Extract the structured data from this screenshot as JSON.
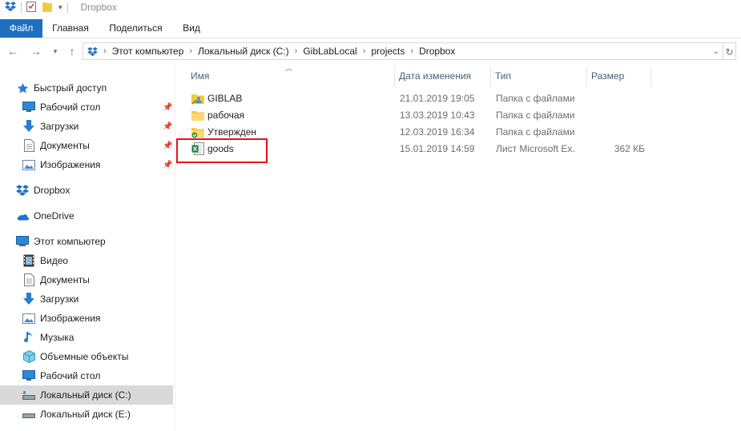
{
  "window": {
    "title": "Dropbox"
  },
  "ribbon": {
    "tabs": [
      "Файл",
      "Главная",
      "Поделиться",
      "Вид"
    ]
  },
  "address": {
    "crumbs": [
      "Этот компьютер",
      "Локальный диск (C:)",
      "GibLabLocal",
      "projects",
      "Dropbox"
    ]
  },
  "sidebar": {
    "items": [
      {
        "label": "Быстрый доступ",
        "icon": "star-icon"
      },
      {
        "label": "Рабочий стол",
        "icon": "desktop-icon",
        "pinned": true
      },
      {
        "label": "Загрузки",
        "icon": "download-icon",
        "pinned": true
      },
      {
        "label": "Документы",
        "icon": "document-icon",
        "pinned": true
      },
      {
        "label": "Изображения",
        "icon": "pictures-icon",
        "pinned": true
      },
      {
        "label": "Dropbox",
        "icon": "dropbox-icon"
      },
      {
        "label": "OneDrive",
        "icon": "onedrive-icon"
      },
      {
        "label": "Этот компьютер",
        "icon": "computer-icon"
      },
      {
        "label": "Видео",
        "icon": "video-icon"
      },
      {
        "label": "Документы",
        "icon": "document-icon"
      },
      {
        "label": "Загрузки",
        "icon": "download-icon"
      },
      {
        "label": "Изображения",
        "icon": "pictures-icon"
      },
      {
        "label": "Музыка",
        "icon": "music-icon"
      },
      {
        "label": "Объемные объекты",
        "icon": "3d-objects-icon"
      },
      {
        "label": "Рабочий стол",
        "icon": "desktop-icon"
      },
      {
        "label": "Локальный диск (C:)",
        "icon": "drive-icon",
        "selected": true
      },
      {
        "label": "Локальный диск (E:)",
        "icon": "drive-icon"
      }
    ]
  },
  "columns": {
    "name": "Имя",
    "date": "Дата изменения",
    "type": "Тип",
    "size": "Размер"
  },
  "files": [
    {
      "name": "GIBLAB",
      "date": "21.01.2019 19:05",
      "type": "Папка с файлами",
      "size": "",
      "icon": "shared-folder-icon"
    },
    {
      "name": "рабочая",
      "date": "13.03.2019 10:43",
      "type": "Папка с файлами",
      "size": "",
      "icon": "folder-icon"
    },
    {
      "name": "Утвержден",
      "date": "12.03.2019 16:34",
      "type": "Папка с файлами",
      "size": "",
      "icon": "synced-folder-icon"
    },
    {
      "name": "goods",
      "date": "15.01.2019 14:59",
      "type": "Лист Microsoft Ex...",
      "size": "362 КБ",
      "icon": "excel-file-icon"
    }
  ],
  "colors": {
    "accent": "#1f6fc0",
    "highlight": "#e8101b",
    "folder": "#f5c842"
  }
}
